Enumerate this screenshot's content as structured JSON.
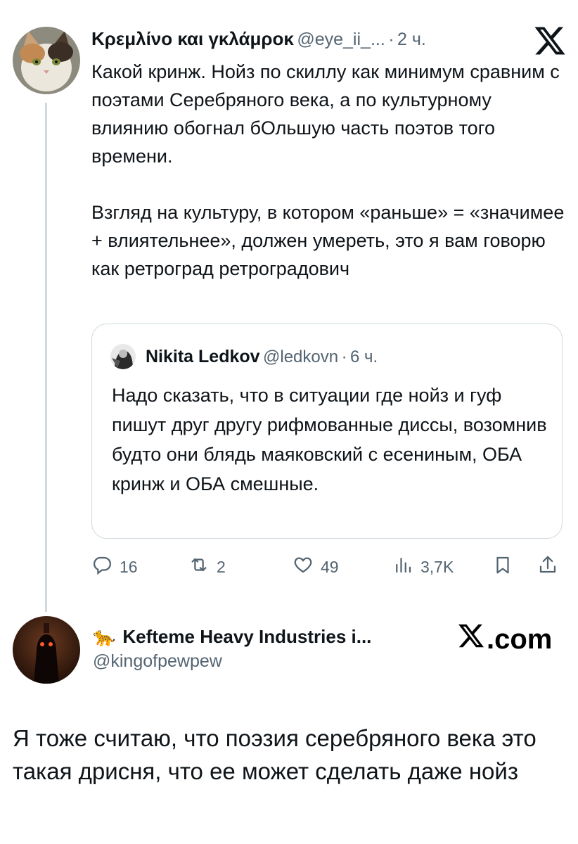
{
  "tweet": {
    "author_name": "Κρεμλίνο και γκλάμροκ",
    "author_handle": "@eye_ii_...",
    "separator": "·",
    "time": "2 ч.",
    "paragraph1": "Какой кринж. Нойз по скиллу как минимум сравним с поэтами Серебряного века, а по культурному влиянию обогнал бОльшую часть поэтов того времени.",
    "paragraph2": "Взгляд на культуру, в котором «раньше» = «значимее + влиятельнее», должен умереть, это я вам говорю как ретроград ретроградович",
    "quote": {
      "author_name": "Nikita Ledkov",
      "author_handle": "@ledkovn",
      "separator": "·",
      "time": "6 ч.",
      "text": "Надо сказать, что в ситуации где нойз и гуф пишут друг другу рифмованные диссы, возомнив будто они блядь маяковский с есениным, ОБА кринж и ОБА смешные."
    },
    "stats": {
      "replies": "16",
      "retweets": "2",
      "likes": "49",
      "views": "3,7K"
    }
  },
  "reply": {
    "author_name": "Kefteme Heavy Industries i...",
    "author_emoji": "🐆",
    "author_handle": "@kingofpewpew",
    "brand": ".com",
    "text": "Я тоже считаю, что поэзия серебряного века это такая дрисня, что ее может сделать даже нойз"
  },
  "icons": [
    "x-logo-icon",
    "reply-icon",
    "retweet-icon",
    "like-icon",
    "views-icon",
    "bookmark-icon",
    "share-icon",
    "leopard-icon"
  ],
  "colors": {
    "text": "#0f1419",
    "secondary": "#536471",
    "border": "#cfd9de"
  }
}
